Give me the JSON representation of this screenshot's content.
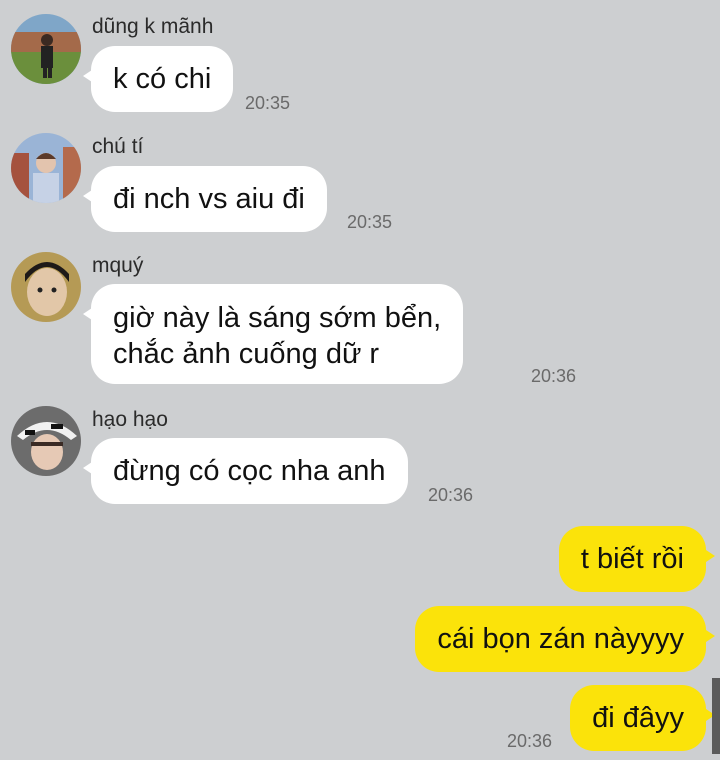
{
  "messages": [
    {
      "sender": "dũng k mãnh",
      "text": "k có chi",
      "time": "20:35"
    },
    {
      "sender": "chú tí",
      "text": "đi nch vs aiu đi",
      "time": "20:35"
    },
    {
      "sender": "mquý",
      "text_line1": "giờ này là sáng sớm bển,",
      "text_line2": "chắc ảnh cuống dữ r",
      "time": "20:36"
    },
    {
      "sender": "hạo hạo",
      "text": "đừng có cọc nha anh",
      "time": "20:36"
    }
  ],
  "outgoing": [
    {
      "text": "t biết rồi"
    },
    {
      "text": "cái bọn zán nàyyyy"
    },
    {
      "text": "đi đâyy",
      "time": "20:36"
    }
  ],
  "colors": {
    "background": "#cdcfd1",
    "incoming_bubble": "#ffffff",
    "outgoing_bubble": "#fbe30a"
  },
  "icons": {
    "avatars": [
      "avatar-dung-k-manh",
      "avatar-chu-ti",
      "avatar-mquy",
      "avatar-hao-hao"
    ]
  }
}
